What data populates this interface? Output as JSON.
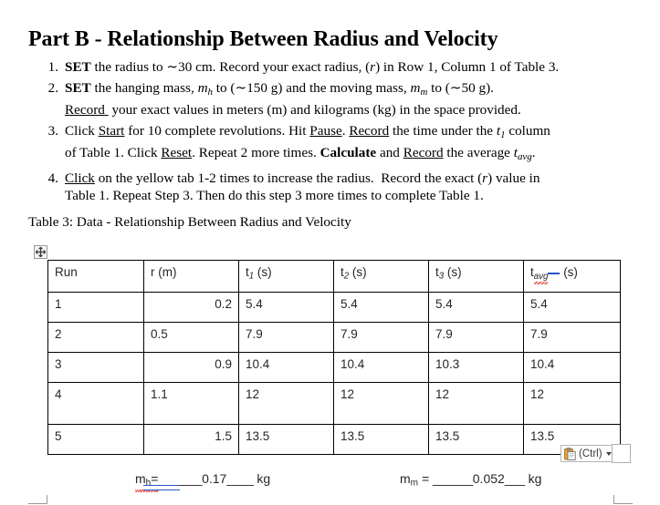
{
  "document": {
    "title": "Part B - Relationship Between Radius and Velocity",
    "steps": [
      {
        "number": "1.",
        "line1_html": "<span class=\"b\">SET</span> the radius to ∼30 cm. Record your exact radius, (<span class=\"it\">r</span>) in Row 1, Column 1 of Table 3."
      },
      {
        "number": "2.",
        "line1_html": "<span class=\"b\">SET</span> the hanging mass, <span class=\"it\">m<sub>h</sub></span> to (∼150 g) and the moving mass, <span class=\"it\">m<sub>m</sub></span> to (∼50 g).",
        "line2_html": "<span class=\"u\">Record&nbsp;</span> your exact values in meters (m) and kilograms (kg) in the space provided."
      },
      {
        "number": "3.",
        "line1_html": "Click <span class=\"u\">Start</span> for 10 complete revolutions. Hit <span class=\"u\">Pause</span>. <span class=\"u\">Record</span> the time under the <span class=\"it\">t</span><sub>1</sub> column",
        "line2_html": "of Table 1. Click <span class=\"u\">Reset</span>. Repeat 2 more times. <span class=\"b\">Calculate</span> and <span class=\"u\">Record</span> the average <span class=\"it\">t<sub>avg</sub></span>."
      },
      {
        "number": "4.",
        "line1_html": "<span class=\"u\">Click</span> on the yellow tab 1-2 times to increase the radius. &nbsp;Record the exact (<span class=\"it\">r</span>) value in",
        "line2_html": "Table 1. Repeat Step 3. Then do this step 3 more times to complete Table 1."
      }
    ],
    "table_caption": "Table 3: Data - Relationship Between Radius and Velocity"
  },
  "table": {
    "headers": [
      {
        "html": "Run"
      },
      {
        "html": "r (m)"
      },
      {
        "html": "t<sub>1</sub> (s)"
      },
      {
        "html": "t<sub>2</sub> (s)"
      },
      {
        "html": "t<sub>3</sub> (s)"
      },
      {
        "html": "t<sub class=\"sq\">avg</sub><span class=\"bluebar\"></span> (s)"
      }
    ],
    "rows": [
      {
        "run": "1",
        "r": "0.2",
        "r_align": "right",
        "t1": "5.4",
        "t2": "5.4",
        "t3": "5.4",
        "tavg": "5.4",
        "tall": false
      },
      {
        "run": "2",
        "r": "0.5",
        "r_align": "left",
        "t1": "7.9",
        "t2": "7.9",
        "t3": "7.9",
        "tavg": "7.9",
        "tall": false
      },
      {
        "run": "3",
        "r": "0.9",
        "r_align": "right",
        "t1": "10.4",
        "t2": "10.4",
        "t3": "10.3",
        "tavg": "10.4",
        "tall": false
      },
      {
        "run": "4",
        "r": "1.1",
        "r_align": "left",
        "t1": "12",
        "t2": "12",
        "t3": "12",
        "tavg": "12",
        "tall": true
      },
      {
        "run": "5",
        "r": "1.5",
        "r_align": "right",
        "t1": "13.5",
        "t2": "13.5",
        "t3": "13.5",
        "tavg": "13.5",
        "tall": false
      }
    ]
  },
  "paste_options": {
    "label": "(Ctrl)",
    "icon": "clipboard-paste-icon",
    "caret": "chevron-down-icon"
  },
  "mass_entries": {
    "hanging": {
      "symbol": "m",
      "subscript": "h",
      "equals": "=",
      "blank_before": "______",
      "value": "0.17",
      "blank_after": "____",
      "unit": "kg"
    },
    "moving": {
      "symbol": "m",
      "subscript": "m",
      "equals": "=",
      "blank_before": "______",
      "value": "0.052",
      "blank_after": "___",
      "unit": "kg"
    }
  },
  "colors": {
    "spelling_error": "#e02b20",
    "grammar_error": "#2a56c6",
    "table_border": "#000000",
    "text": "#000000"
  }
}
